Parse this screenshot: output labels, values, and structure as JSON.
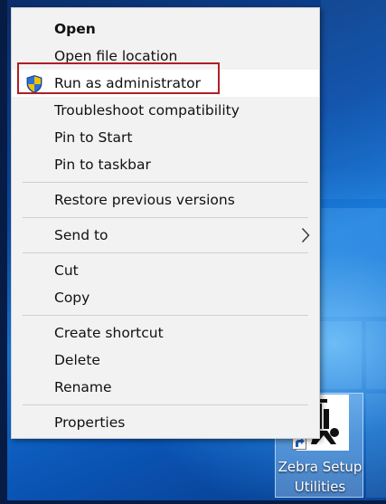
{
  "menu": {
    "items": [
      {
        "label": "Open"
      },
      {
        "label": "Open file location"
      },
      {
        "label": "Run as administrator"
      },
      {
        "label": "Troubleshoot compatibility"
      },
      {
        "label": "Pin to Start"
      },
      {
        "label": "Pin to taskbar"
      },
      {
        "label": "Restore previous versions"
      },
      {
        "label": "Send to"
      },
      {
        "label": "Cut"
      },
      {
        "label": "Copy"
      },
      {
        "label": "Create shortcut"
      },
      {
        "label": "Delete"
      },
      {
        "label": "Rename"
      },
      {
        "label": "Properties"
      }
    ]
  },
  "desktop_icon": {
    "label_line1": "Zebra Setup",
    "label_line2": "Utilities"
  },
  "colors": {
    "menu_bg": "#f2f2f2",
    "highlight_border": "#b01e23",
    "shield_blue": "#1f5bbf",
    "shield_yellow": "#f2c200"
  }
}
